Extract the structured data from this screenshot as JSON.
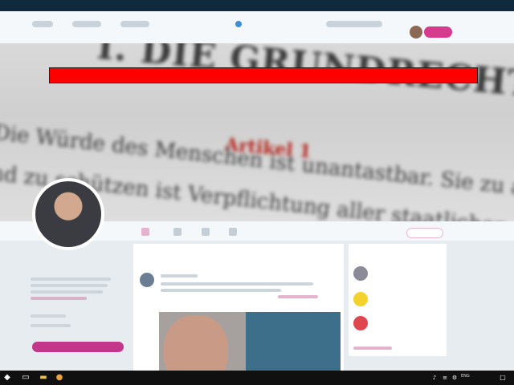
{
  "window": {
    "header_button_label": ""
  },
  "banner": {
    "heading": "I. DIE GRUNDRECHTE",
    "article": "Artikel 1",
    "line1": "Die Würde des Menschen ist unantastbar. Sie zu achten",
    "line2": "und zu schützen ist Verpflichtung aller staatlichen"
  },
  "profile": {
    "name": ""
  },
  "timeline": {
    "tabs": [],
    "image_label": ""
  },
  "who_to_follow": {
    "title": "",
    "names": []
  },
  "taskbar": {
    "language": "ENG",
    "time": "",
    "date": ""
  },
  "colors": {
    "accent": "#d63a8d",
    "redaction": "#ff0000",
    "taskbar": "#101010"
  }
}
